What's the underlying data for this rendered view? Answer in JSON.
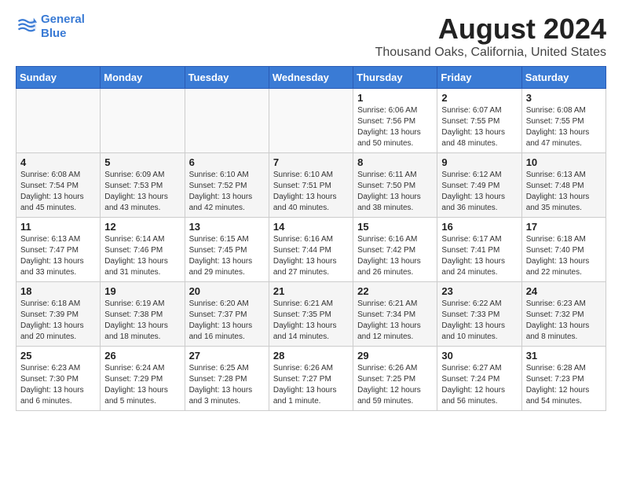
{
  "logo": {
    "line1": "General",
    "line2": "Blue"
  },
  "title": "August 2024",
  "subtitle": "Thousand Oaks, California, United States",
  "weekdays": [
    "Sunday",
    "Monday",
    "Tuesday",
    "Wednesday",
    "Thursday",
    "Friday",
    "Saturday"
  ],
  "weeks": [
    [
      {
        "day": "",
        "info": ""
      },
      {
        "day": "",
        "info": ""
      },
      {
        "day": "",
        "info": ""
      },
      {
        "day": "",
        "info": ""
      },
      {
        "day": "1",
        "info": "Sunrise: 6:06 AM\nSunset: 7:56 PM\nDaylight: 13 hours\nand 50 minutes."
      },
      {
        "day": "2",
        "info": "Sunrise: 6:07 AM\nSunset: 7:55 PM\nDaylight: 13 hours\nand 48 minutes."
      },
      {
        "day": "3",
        "info": "Sunrise: 6:08 AM\nSunset: 7:55 PM\nDaylight: 13 hours\nand 47 minutes."
      }
    ],
    [
      {
        "day": "4",
        "info": "Sunrise: 6:08 AM\nSunset: 7:54 PM\nDaylight: 13 hours\nand 45 minutes."
      },
      {
        "day": "5",
        "info": "Sunrise: 6:09 AM\nSunset: 7:53 PM\nDaylight: 13 hours\nand 43 minutes."
      },
      {
        "day": "6",
        "info": "Sunrise: 6:10 AM\nSunset: 7:52 PM\nDaylight: 13 hours\nand 42 minutes."
      },
      {
        "day": "7",
        "info": "Sunrise: 6:10 AM\nSunset: 7:51 PM\nDaylight: 13 hours\nand 40 minutes."
      },
      {
        "day": "8",
        "info": "Sunrise: 6:11 AM\nSunset: 7:50 PM\nDaylight: 13 hours\nand 38 minutes."
      },
      {
        "day": "9",
        "info": "Sunrise: 6:12 AM\nSunset: 7:49 PM\nDaylight: 13 hours\nand 36 minutes."
      },
      {
        "day": "10",
        "info": "Sunrise: 6:13 AM\nSunset: 7:48 PM\nDaylight: 13 hours\nand 35 minutes."
      }
    ],
    [
      {
        "day": "11",
        "info": "Sunrise: 6:13 AM\nSunset: 7:47 PM\nDaylight: 13 hours\nand 33 minutes."
      },
      {
        "day": "12",
        "info": "Sunrise: 6:14 AM\nSunset: 7:46 PM\nDaylight: 13 hours\nand 31 minutes."
      },
      {
        "day": "13",
        "info": "Sunrise: 6:15 AM\nSunset: 7:45 PM\nDaylight: 13 hours\nand 29 minutes."
      },
      {
        "day": "14",
        "info": "Sunrise: 6:16 AM\nSunset: 7:44 PM\nDaylight: 13 hours\nand 27 minutes."
      },
      {
        "day": "15",
        "info": "Sunrise: 6:16 AM\nSunset: 7:42 PM\nDaylight: 13 hours\nand 26 minutes."
      },
      {
        "day": "16",
        "info": "Sunrise: 6:17 AM\nSunset: 7:41 PM\nDaylight: 13 hours\nand 24 minutes."
      },
      {
        "day": "17",
        "info": "Sunrise: 6:18 AM\nSunset: 7:40 PM\nDaylight: 13 hours\nand 22 minutes."
      }
    ],
    [
      {
        "day": "18",
        "info": "Sunrise: 6:18 AM\nSunset: 7:39 PM\nDaylight: 13 hours\nand 20 minutes."
      },
      {
        "day": "19",
        "info": "Sunrise: 6:19 AM\nSunset: 7:38 PM\nDaylight: 13 hours\nand 18 minutes."
      },
      {
        "day": "20",
        "info": "Sunrise: 6:20 AM\nSunset: 7:37 PM\nDaylight: 13 hours\nand 16 minutes."
      },
      {
        "day": "21",
        "info": "Sunrise: 6:21 AM\nSunset: 7:35 PM\nDaylight: 13 hours\nand 14 minutes."
      },
      {
        "day": "22",
        "info": "Sunrise: 6:21 AM\nSunset: 7:34 PM\nDaylight: 13 hours\nand 12 minutes."
      },
      {
        "day": "23",
        "info": "Sunrise: 6:22 AM\nSunset: 7:33 PM\nDaylight: 13 hours\nand 10 minutes."
      },
      {
        "day": "24",
        "info": "Sunrise: 6:23 AM\nSunset: 7:32 PM\nDaylight: 13 hours\nand 8 minutes."
      }
    ],
    [
      {
        "day": "25",
        "info": "Sunrise: 6:23 AM\nSunset: 7:30 PM\nDaylight: 13 hours\nand 6 minutes."
      },
      {
        "day": "26",
        "info": "Sunrise: 6:24 AM\nSunset: 7:29 PM\nDaylight: 13 hours\nand 5 minutes."
      },
      {
        "day": "27",
        "info": "Sunrise: 6:25 AM\nSunset: 7:28 PM\nDaylight: 13 hours\nand 3 minutes."
      },
      {
        "day": "28",
        "info": "Sunrise: 6:26 AM\nSunset: 7:27 PM\nDaylight: 13 hours\nand 1 minute."
      },
      {
        "day": "29",
        "info": "Sunrise: 6:26 AM\nSunset: 7:25 PM\nDaylight: 12 hours\nand 59 minutes."
      },
      {
        "day": "30",
        "info": "Sunrise: 6:27 AM\nSunset: 7:24 PM\nDaylight: 12 hours\nand 56 minutes."
      },
      {
        "day": "31",
        "info": "Sunrise: 6:28 AM\nSunset: 7:23 PM\nDaylight: 12 hours\nand 54 minutes."
      }
    ]
  ]
}
